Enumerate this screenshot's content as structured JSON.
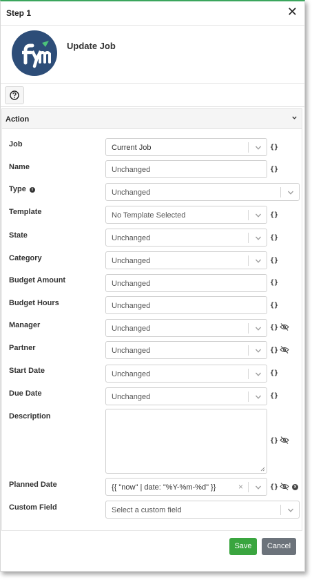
{
  "dialog": {
    "title": "Step 1"
  },
  "header": {
    "job_title": "Update Job"
  },
  "colors": {
    "accent": "#3aa55c",
    "logo_bg": "#2d4d78",
    "save": "#3aa53f",
    "cancel": "#6c737b"
  },
  "section": {
    "title": "Action"
  },
  "fields": {
    "job": {
      "label": "Job",
      "value": "Current Job"
    },
    "name": {
      "label": "Name",
      "value": "Unchanged"
    },
    "type": {
      "label": "Type",
      "value": "Unchanged"
    },
    "template": {
      "label": "Template",
      "value": "No Template Selected"
    },
    "state": {
      "label": "State",
      "value": "Unchanged"
    },
    "category": {
      "label": "Category",
      "value": "Unchanged"
    },
    "budget_amount": {
      "label": "Budget Amount",
      "value": "Unchanged"
    },
    "budget_hours": {
      "label": "Budget Hours",
      "value": "Unchanged"
    },
    "manager": {
      "label": "Manager",
      "value": "Unchanged"
    },
    "partner": {
      "label": "Partner",
      "value": "Unchanged"
    },
    "start_date": {
      "label": "Start Date",
      "value": "Unchanged"
    },
    "due_date": {
      "label": "Due Date",
      "value": "Unchanged"
    },
    "description": {
      "label": "Description",
      "value": ""
    },
    "planned_date": {
      "label": "Planned Date",
      "value": "{{ \"now\" | date: \"%Y-%m-%d\" }}"
    },
    "custom_field": {
      "label": "Custom Field",
      "value": "Select a custom field"
    }
  },
  "symbols": {
    "brace": "{}",
    "close": "✕",
    "clear": "×",
    "info": "i",
    "remove": "×"
  },
  "buttons": {
    "save": "Save",
    "cancel": "Cancel"
  }
}
